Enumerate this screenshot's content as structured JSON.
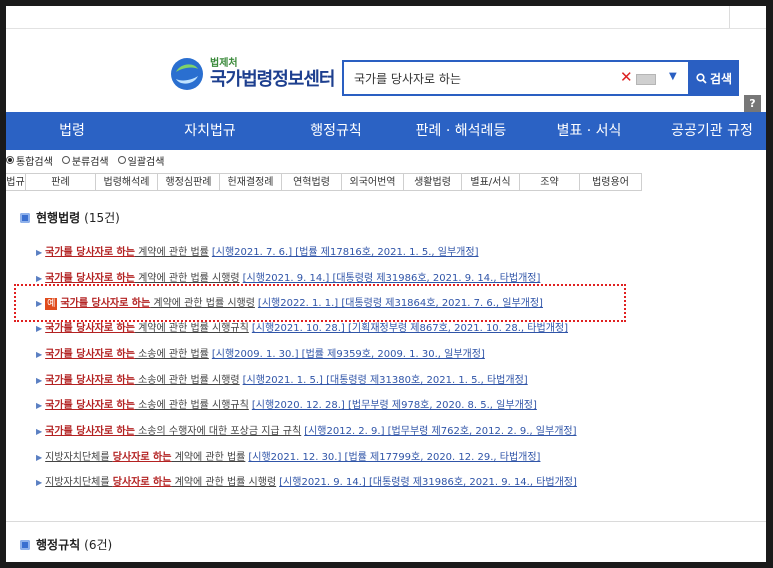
{
  "header": {
    "logo_sub": "법제처",
    "logo_main": "국가법령정보센터",
    "search_value": "국가를 당사자로 하는",
    "search_button": "검색",
    "help": "?"
  },
  "nav": [
    "법령",
    "자치법규",
    "행정규칙",
    "판례 · 해석례등",
    "별표 · 서식",
    "공공기관 규정"
  ],
  "search_modes": [
    "통합검색",
    "분류검색",
    "일괄검색"
  ],
  "tabs": [
    "법규",
    "판례",
    "법령해석례",
    "행정심판례",
    "헌재결정례",
    "연혁법령",
    "외국어번역",
    "생활법령",
    "별표/서식",
    "조약",
    "법령용어"
  ],
  "sections": {
    "current_laws": {
      "title": "현행법령",
      "count": "(15건)"
    },
    "admin_rules": {
      "title": "행정규칙",
      "count": "(6건)"
    }
  },
  "results": [
    {
      "pre": "",
      "kw": "국가를 당사자로 하는",
      "rest": " 계약에 관한 법률",
      "meta": "[시행2021. 7. 6.] [법률 제17816호, 2021. 1. 5., 일부개정]"
    },
    {
      "pre": "",
      "kw": "국가를 당사자로 하는",
      "rest": " 계약에 관한 법률 시행령",
      "meta": "[시행2021. 9. 14.] [대통령령 제31986호, 2021. 9. 14., 타법개정]"
    },
    {
      "pre": "",
      "badge": "예",
      "kw": "국가를 당사자로 하는",
      "rest": " 계약에 관한 법률 시행령",
      "meta": "[시행2022. 1. 1.] [대통령령 제31864호, 2021. 7. 6., 일부개정]"
    },
    {
      "pre": "",
      "kw": "국가를 당사자로 하는",
      "rest": " 계약에 관한 법률 시행규칙",
      "meta": "[시행2021. 10. 28.] [기획재정부령 제867호, 2021. 10. 28., 타법개정]"
    },
    {
      "pre": "",
      "kw": "국가를 당사자로 하는",
      "rest": " 소송에 관한 법률",
      "meta": "[시행2009. 1. 30.] [법률 제9359호, 2009. 1. 30., 일부개정]"
    },
    {
      "pre": "",
      "kw": "국가를 당사자로 하는",
      "rest": " 소송에 관한 법률 시행령",
      "meta": "[시행2021. 1. 5.] [대통령령 제31380호, 2021. 1. 5., 타법개정]"
    },
    {
      "pre": "",
      "kw": "국가를 당사자로 하는",
      "rest": " 소송에 관한 법률 시행규칙",
      "meta": "[시행2020. 12. 28.] [법무부령 제978호, 2020. 8. 5., 일부개정]"
    },
    {
      "pre": "",
      "kw": "국가를 당사자로 하는",
      "rest": " 소송의 수행자에 대한 포상금 지급 규칙",
      "meta": "[시행2012. 2. 9.] [법무부령 제762호, 2012. 2. 9., 일부개정]"
    },
    {
      "pre": "지방자치단체를 ",
      "kw": "당사자로 하는",
      "rest": " 계약에 관한 법률",
      "meta": "[시행2021. 12. 30.] [법률 제17799호, 2020. 12. 29., 타법개정]"
    },
    {
      "pre": "지방자치단체를 ",
      "kw": "당사자로 하는",
      "rest": " 계약에 관한 법률 시행령",
      "meta": "[시행2021. 9. 14.] [대통령령 제31986호, 2021. 9. 14., 타법개정]"
    }
  ],
  "colors": {
    "nav_bg": "#2b62c4",
    "keyword": "#b32222",
    "meta_link": "#3055a8",
    "highlight_border": "#e02020"
  }
}
